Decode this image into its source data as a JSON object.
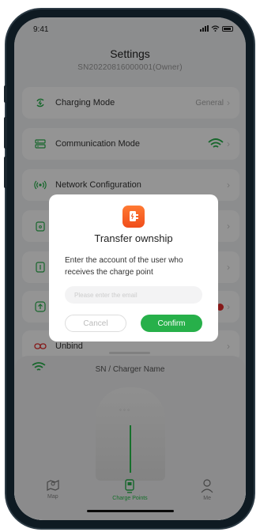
{
  "status": {
    "time": "9:41"
  },
  "header": {
    "title": "Settings",
    "subtitle": "SN20220816000001(Owner)"
  },
  "menu": {
    "charging_mode": {
      "label": "Charging Mode",
      "value": "General"
    },
    "communication_mode": {
      "label": "Communication Mode"
    },
    "network_config": {
      "label": "Network Configuration"
    },
    "unbind": {
      "label": "Unbind"
    }
  },
  "sheet": {
    "title": "SN / Charger Name"
  },
  "tabs": [
    {
      "label": "Map"
    },
    {
      "label": "Charge Points"
    },
    {
      "label": "Me"
    }
  ],
  "dialog": {
    "title": "Transfer ownship",
    "message": "Enter the account of the user who receives the charge point",
    "input_placeholder": "Please enter the email",
    "cancel_label": "Cancel",
    "confirm_label": "Confirm"
  },
  "colors": {
    "accent": "#27b04a",
    "logo": "#f05a22",
    "alert": "#e52a2a"
  }
}
